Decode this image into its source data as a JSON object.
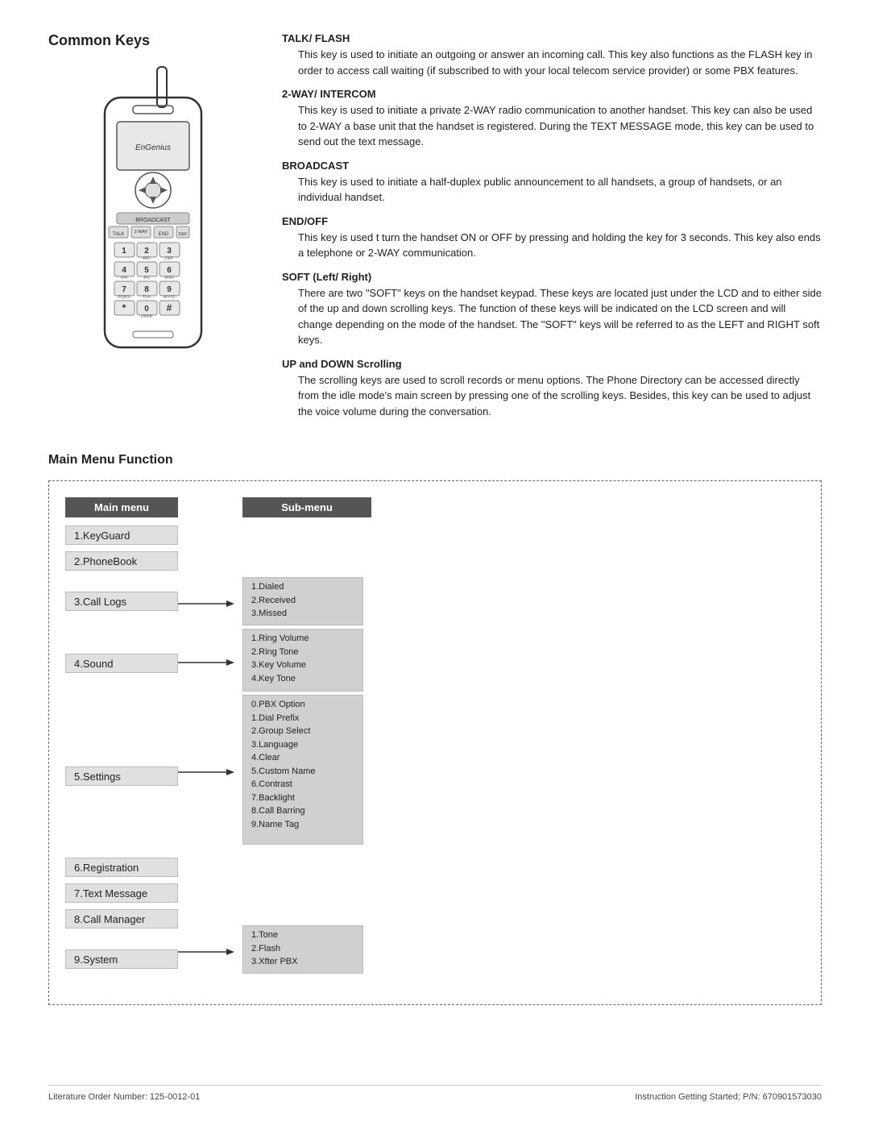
{
  "page": {
    "title": "Common Keys",
    "bottom_title": "Main Menu Function",
    "footer": {
      "left": "Literature Order Number:  125-0012-01",
      "right": "Instruction Getting Started; P/N: 670901573030"
    }
  },
  "keys": [
    {
      "title": "TALK/ FLASH",
      "description": "This key is used to initiate an outgoing or answer an incoming call. This key also functions as the FLASH key in order to access call waiting (if subscribed to with your local telecom service provider) or some PBX features."
    },
    {
      "title": "2-WAY/ INTERCOM",
      "description": "This key is used to initiate a private 2-WAY radio communication to another handset. This key can also be used to 2-WAY a base unit that the handset is registered. During the TEXT MESSAGE mode, this key can be used to send out the text message."
    },
    {
      "title": "BROADCAST",
      "description": "This key is used to initiate a half-duplex public announcement to all handsets, a group of handsets, or an individual handset."
    },
    {
      "title": "END/OFF",
      "description": "This key is used t turn the handset ON or OFF by pressing and holding the key for 3 seconds. This key also ends a telephone or 2-WAY communication."
    },
    {
      "title": "SOFT (Left/ Right)",
      "description": "There are two \"SOFT\" keys on the handset keypad. These keys are located just under the LCD and to either side of the up and down scrolling keys. The function of these keys will be indicated on the LCD screen and will change depending on the mode of the handset. The \"SOFT\" keys will be referred to as the LEFT and RIGHT soft keys."
    },
    {
      "title": "UP and DOWN Scrolling",
      "description": "The scrolling keys are used to scroll records or menu options. The Phone Directory can be accessed directly from the idle mode's main screen by pressing one of the scrolling keys. Besides, this key can be used to adjust the voice volume during the conversation."
    }
  ],
  "menu": {
    "main_header": "Main menu",
    "sub_header": "Sub-menu",
    "items": [
      {
        "label": "1.KeyGuard",
        "has_sub": false,
        "sub_items": []
      },
      {
        "label": "2.PhoneBook",
        "has_sub": false,
        "sub_items": []
      },
      {
        "label": "3.Call Logs",
        "has_sub": true,
        "sub_items": [
          "1.Dialed",
          "2.Received",
          "3.Missed"
        ]
      },
      {
        "label": "4.Sound",
        "has_sub": true,
        "sub_items": [
          "1.Ring Volume",
          "2.Ring Tone",
          "3.Key Volume",
          "4.Key Tone"
        ]
      },
      {
        "label": "5.Settings",
        "has_sub": true,
        "sub_items": [
          "0.PBX Option",
          "1.Dial Prefix",
          "2.Group Select",
          "3.Language",
          "4.Clear",
          "5.Custom Name",
          "6.Contrast",
          "7.Backlight",
          "8.Call Barring",
          "9.Name Tag"
        ]
      },
      {
        "label": "6.Registration",
        "has_sub": false,
        "sub_items": []
      },
      {
        "label": "7.Text Message",
        "has_sub": false,
        "sub_items": []
      },
      {
        "label": "8.Call Manager",
        "has_sub": false,
        "sub_items": []
      },
      {
        "label": "9.System",
        "has_sub": true,
        "sub_items": [
          "1.Tone",
          "2.Flash",
          "3.Xfter PBX"
        ]
      }
    ]
  }
}
